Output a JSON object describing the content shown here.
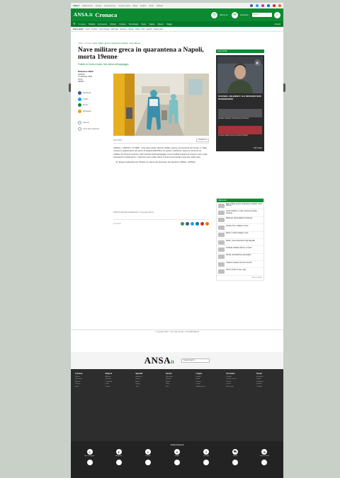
{
  "colors": {
    "brand_green": "#0b8a32",
    "nav_green": "#067a2a",
    "footer_bg": "#2d2d2d",
    "page_bg": "#c8d0c8"
  },
  "topstrip": {
    "items": [
      "ANSA.it",
      "Mediterraneo",
      "Europa",
      "Nuova Europa",
      "America Latina",
      "Brasil",
      "English",
      "Photo",
      "Podcast"
    ],
    "social_icons": [
      "facebook-icon",
      "twitter-icon",
      "instagram-icon",
      "linkedin-icon",
      "youtube-icon",
      "rss-icon"
    ]
  },
  "brand": {
    "logo": "ANSA.it",
    "section": "Cronaca",
    "btn1": "Ultima ora",
    "btn2": "Newsletter",
    "search_placeholder": "Cerca..."
  },
  "nav": {
    "items": [
      "Cronaca",
      "Politica",
      "Economia",
      "Mondo",
      "Cultura",
      "Tecnologia",
      "Sport",
      "Salute",
      "Motori",
      "Viaggi"
    ],
    "login": "Accedi"
  },
  "subnav": {
    "label": "Primo piano",
    "items": [
      "Covid",
      "Ucraina",
      "Caro energia",
      "Quirinale",
      "Sanremo",
      "Meteo",
      "Video",
      "Foto",
      "Vaccini",
      "Green pass"
    ]
  },
  "breadcrumb": {
    "home": "ANSA",
    "section": "Cronaca",
    "current": "Nave militare greca in quarantena a Napoli, morta 19enne"
  },
  "article": {
    "headline": "Nave militare greca in quarantena a Napoli, morta 19enne",
    "summary": "Positivi al Covid a bordo, test esteso all'equipaggio",
    "author_label": "Redazione ANSA",
    "place": "NAPOLI",
    "date": "17 febbraio 2022",
    "time": "12:41",
    "news_label": "NEWS",
    "share": [
      "Facebook",
      "Twitter",
      "Email",
      "Whatsapp"
    ],
    "tools": [
      "Stampa",
      "Scrivi alla redazione"
    ],
    "caption_left": "Foto ANSA",
    "caption_button": "Suggerisci",
    "body": [
      "(ANSA) - NAPOLI, 17 FEB - Una nave della marina militare greca, proveniente da Creta, e' stata messa in quarantena nel porto di Napoli dall'Ufficio di sanita' marittima, dopo la morte di un militare di 19 anni a bordo. Altri membri dell'equipaggio sono risultati positivi al Covid e sono stati sottoposti a isolamento. I tamponi sono stati estesi a tutto il personale presente sulla nave.",
      "E' attesa l'autopsia per chiarire le cause del decesso del giovane militare. (ANSA)."
    ],
    "photo_credit": "RIPRODUZIONE RISERVATA © Copyright ANSA",
    "share_label": "Condividi"
  },
  "sidebar": {
    "video_label": "Video ANSA",
    "video_title": "UCRAINA, ZELENSKY: GLI INVASORI NON PASSERANNO",
    "video_items": [
      "Ucraina, Zelensky: 'Ricostruiremo il Paese'",
      "La nave militare greca nel porto di Napoli"
    ],
    "video_more": "Tutti i video",
    "news_label": "Ultima ora",
    "news_items": [
      "Nave militare greca in quarantena a Napoli, morta 19enne",
      "Covid, bollettino: in calo i ricoveri in terapia intensiva",
      "Maltempo, allerta gialla in Campania",
      "Ucraina, Kiev: colloqui in corso",
      "Meteo, in arrivo pioggia e neve",
      "Sanita', nuove assunzioni negli ospedali",
      "Incidente stradale sulla A1, un ferito",
      "Scuola, test gratuiti per gli studenti",
      "Trasporti, sciopero dei treni venerdi'",
      "Prezzi, rincari su luce e gas"
    ],
    "news_more": "Tutte le notizie"
  },
  "footer": {
    "legal": "© Copyright ANSA - Tutti i diritti riservati - P.IVA 00876481003",
    "logo": "ANSA",
    "logo_mark": "it",
    "select_label": "Scegli regione",
    "columns": [
      {
        "head": "Cronaca",
        "items": [
          "Politica",
          "Economia",
          "Mondo",
          "Cultura",
          "Sport"
        ]
      },
      {
        "head": "Regioni",
        "items": [
          "Abruzzo",
          "Calabria",
          "Campania",
          "Lazio",
          "Veneto"
        ]
      },
      {
        "head": "Speciali",
        "items": [
          "Ambiente",
          "Salute",
          "Motori",
          "Viaggi",
          "Tech"
        ]
      },
      {
        "head": "Servizi",
        "items": [
          "Newsletter",
          "Podcast",
          "Meteo",
          "Video",
          "Foto"
        ]
      },
      {
        "head": "Lingue",
        "items": [
          "English",
          "Brasil",
          "Europa",
          "Latina",
          "Mediterraneo"
        ]
      },
      {
        "head": "Chi siamo",
        "items": [
          "Contatti",
          "Lavora con noi",
          "Privacy",
          "Cookie",
          "Note legali"
        ]
      },
      {
        "head": "Social",
        "items": [
          "Facebook",
          "Twitter",
          "Instagram",
          "Youtube",
          "Linkedin"
        ]
      }
    ],
    "regions_title": "ANSA Network",
    "regions": [
      "Ansa Viaggiart",
      "Ambiente",
      "Europa",
      "Salute",
      "Lifestyle",
      "Motori",
      "Terra & Gusto"
    ]
  }
}
